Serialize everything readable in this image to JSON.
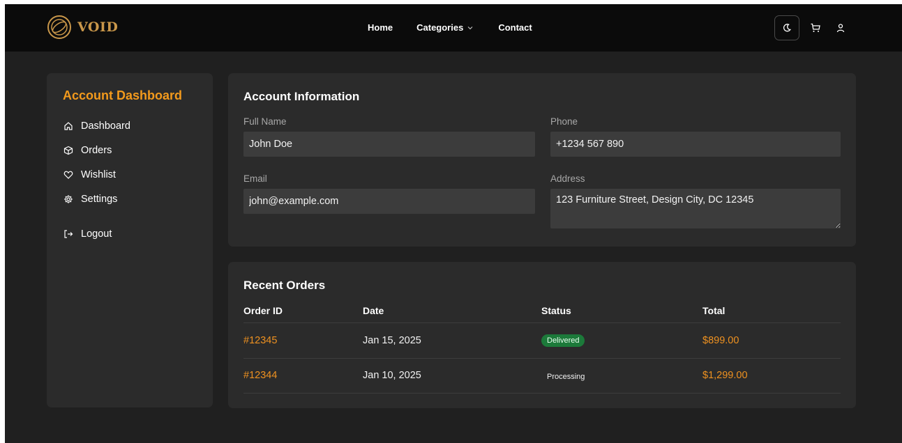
{
  "brand": {
    "name": "VOID",
    "color": "#c9974a"
  },
  "nav": {
    "links": [
      "Home",
      "Categories",
      "Contact"
    ],
    "categories_icon": "chevron-down-icon"
  },
  "actions": {
    "icons": [
      "moon-icon",
      "cart-icon",
      "user-icon"
    ]
  },
  "sidebar": {
    "title": "Account Dashboard",
    "items": [
      {
        "label": "Dashboard",
        "icon": "home-icon"
      },
      {
        "label": "Orders",
        "icon": "box-icon"
      },
      {
        "label": "Wishlist",
        "icon": "heart-icon"
      },
      {
        "label": "Settings",
        "icon": "gear-icon"
      },
      {
        "label": "Logout",
        "icon": "logout-icon"
      }
    ],
    "accent": "#f39a1c"
  },
  "account": {
    "title": "Account Information",
    "full_name_label": "Full Name",
    "full_name": "John Doe",
    "phone_label": "Phone",
    "phone": "+1234 567 890",
    "email_label": "Email",
    "email": "john@example.com",
    "address_label": "Address",
    "address": "123 Furniture Street, Design City, DC 12345"
  },
  "orders": {
    "title": "Recent Orders",
    "columns": [
      "Order ID",
      "Date",
      "Status",
      "Total"
    ],
    "rows": [
      {
        "id": "#12345",
        "date": "Jan 15, 2025",
        "status": "Delivered",
        "total": "$899.00"
      },
      {
        "id": "#12344",
        "date": "Jan 10, 2025",
        "status": "Processing",
        "total": "$1,299.00"
      }
    ],
    "status_colors": {
      "Delivered": "#1c7a3a"
    },
    "accent": "#ee9120"
  }
}
